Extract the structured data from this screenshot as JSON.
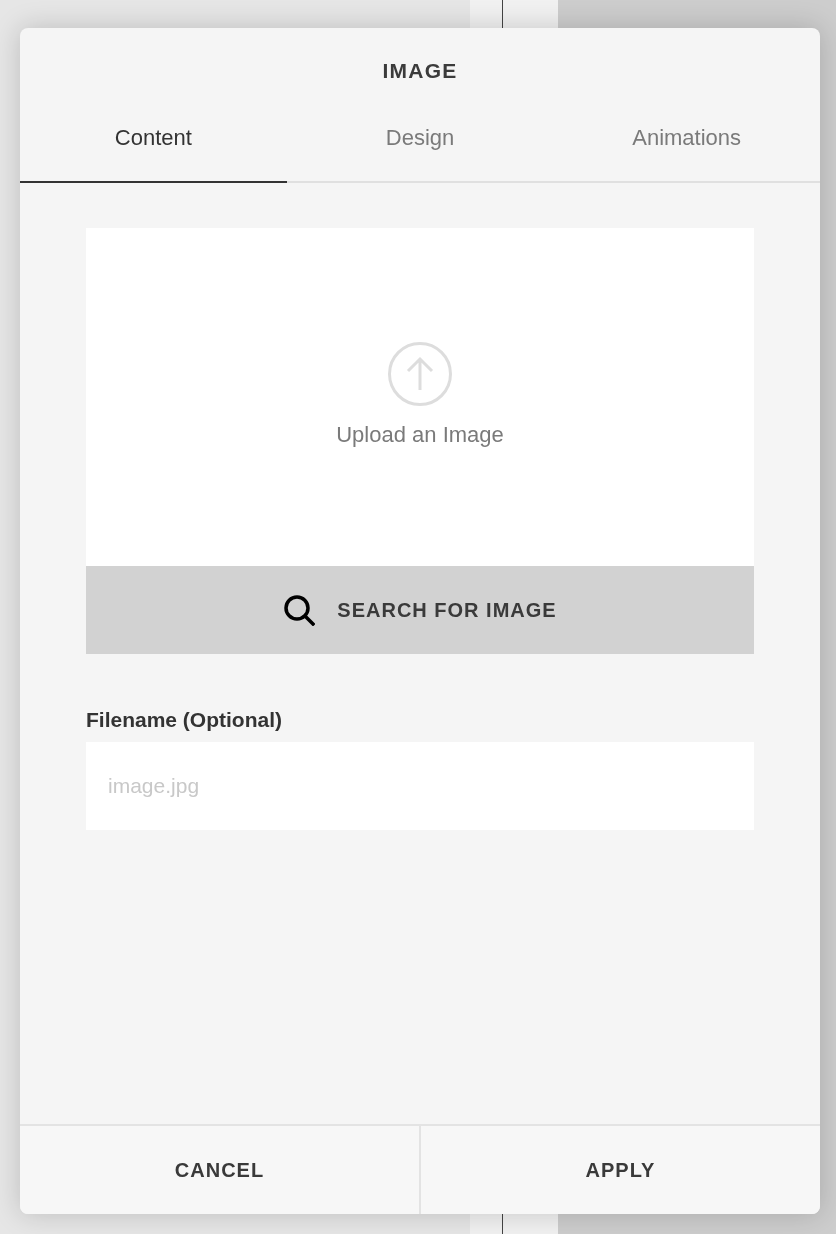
{
  "dialog": {
    "title": "IMAGE"
  },
  "tabs": [
    {
      "label": "Content",
      "selected": true
    },
    {
      "label": "Design",
      "selected": false
    },
    {
      "label": "Animations",
      "selected": false
    }
  ],
  "upload": {
    "label": "Upload an Image"
  },
  "search_button": {
    "label": "SEARCH FOR IMAGE"
  },
  "filename": {
    "label": "Filename (Optional)",
    "placeholder": "image.jpg"
  },
  "buttons": [
    {
      "label": "CANCEL"
    },
    {
      "label": "APPLY"
    }
  ]
}
